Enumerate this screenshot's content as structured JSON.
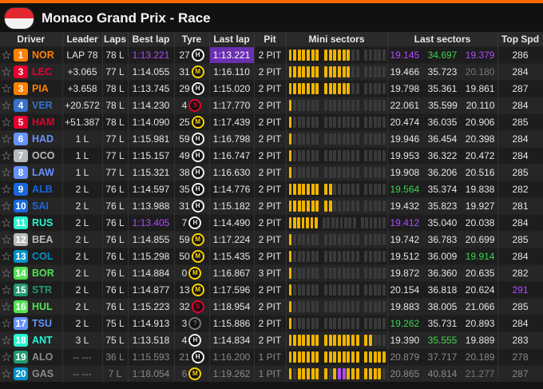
{
  "header": {
    "title": "Monaco Grand Prix - Race",
    "flag_top": "#e4262f",
    "flag_bottom": "#f2f2f2"
  },
  "columns": [
    "Driver",
    "Leader",
    "Laps",
    "Best lap",
    "Tyre",
    "Last lap",
    "Pit",
    "Mini sectors",
    "Last sectors",
    "Top Spd"
  ],
  "colors": {
    "accent": "#ff6a00",
    "purple": "#b04cff",
    "green": "#3fd44f",
    "yellow": "#f0b400",
    "grey": "#3a3a3a"
  },
  "rows": [
    {
      "pos": "1",
      "code": "NOR",
      "team_color": "#ff8000",
      "leader": "LAP 78",
      "laps": "78 L",
      "best": "1:13.221",
      "best_c": "purple",
      "tyre_age": "27",
      "tyre": "H",
      "tyre_color": "#f2f2f2",
      "last": "1:13.221",
      "last_c": "purplebg",
      "pit": "2 PIT",
      "mini": "yyyyyyyyyyyyyggggggg",
      "s1": "19.145",
      "s1c": "purple",
      "s2": "34.697",
      "s2c": "green",
      "s3": "19.379",
      "s3c": "purple",
      "spd": "286",
      "spdc": ""
    },
    {
      "pos": "3",
      "code": "LEC",
      "team_color": "#e8002d",
      "leader": "+3.065",
      "laps": "77 L",
      "best": "1:14.055",
      "best_c": "",
      "tyre_age": "31",
      "tyre": "M",
      "tyre_color": "#ffd400",
      "last": "1:16.110",
      "last_c": "",
      "pit": "2 PIT",
      "mini": "yyyyyyyyyyyyyggggggg",
      "s1": "19.466",
      "s1c": "",
      "s2": "35.723",
      "s2c": "",
      "s3": "20.180",
      "s3c": "dim",
      "spd": "284",
      "spdc": ""
    },
    {
      "pos": "3",
      "code": "PIA",
      "team_color": "#ff8000",
      "leader": "+3.658",
      "laps": "78 L",
      "best": "1:13.745",
      "best_c": "",
      "tyre_age": "29",
      "tyre": "H",
      "tyre_color": "#f2f2f2",
      "last": "1:15.020",
      "last_c": "",
      "pit": "2 PIT",
      "mini": "yyyyyyyyyyyyyggggggg",
      "s1": "19.798",
      "s1c": "",
      "s2": "35.361",
      "s2c": "",
      "s3": "19.861",
      "s3c": "",
      "spd": "287",
      "spdc": ""
    },
    {
      "pos": "4",
      "code": "VER",
      "team_color": "#3671c6",
      "leader": "+20.572",
      "laps": "78 L",
      "best": "1:14.230",
      "best_c": "",
      "tyre_age": "4",
      "tyre": "S",
      "tyre_color": "#e8002d",
      "last": "1:17.770",
      "last_c": "",
      "pit": "2 PIT",
      "mini": "yggggggggggggggggggg",
      "s1": "22.061",
      "s1c": "",
      "s2": "35.599",
      "s2c": "",
      "s3": "20.110",
      "s3c": "",
      "spd": "284",
      "spdc": ""
    },
    {
      "pos": "5",
      "code": "HAM",
      "team_color": "#e8002d",
      "leader": "+51.387",
      "laps": "78 L",
      "best": "1:14.090",
      "best_c": "",
      "tyre_age": "25",
      "tyre": "M",
      "tyre_color": "#ffd400",
      "last": "1:17.439",
      "last_c": "",
      "pit": "2 PIT",
      "mini": "yggggggggggggggggggg",
      "s1": "20.474",
      "s1c": "",
      "s2": "36.035",
      "s2c": "",
      "s3": "20.906",
      "s3c": "",
      "spd": "285",
      "spdc": ""
    },
    {
      "pos": "6",
      "code": "HAD",
      "team_color": "#6692ff",
      "leader": "1 L",
      "laps": "77 L",
      "best": "1:15.981",
      "best_c": "",
      "tyre_age": "59",
      "tyre": "H",
      "tyre_color": "#f2f2f2",
      "last": "1:16.798",
      "last_c": "",
      "pit": "2 PIT",
      "mini": "yggggggggggggggggggg",
      "s1": "19.946",
      "s1c": "",
      "s2": "36.454",
      "s2c": "",
      "s3": "20.398",
      "s3c": "",
      "spd": "284",
      "spdc": ""
    },
    {
      "pos": "7",
      "code": "OCO",
      "team_color": "#b6babd",
      "leader": "1 L",
      "laps": "77 L",
      "best": "1:15.157",
      "best_c": "",
      "tyre_age": "49",
      "tyre": "H",
      "tyre_color": "#f2f2f2",
      "last": "1:16.747",
      "last_c": "",
      "pit": "2 PIT",
      "mini": "yggggggggggggggggggg",
      "s1": "19.953",
      "s1c": "",
      "s2": "36.322",
      "s2c": "",
      "s3": "20.472",
      "s3c": "",
      "spd": "284",
      "spdc": ""
    },
    {
      "pos": "8",
      "code": "LAW",
      "team_color": "#6692ff",
      "leader": "1 L",
      "laps": "77 L",
      "best": "1:15.321",
      "best_c": "",
      "tyre_age": "38",
      "tyre": "H",
      "tyre_color": "#f2f2f2",
      "last": "1:16.630",
      "last_c": "",
      "pit": "2 PIT",
      "mini": "yggggggggggggggggggg",
      "s1": "19.908",
      "s1c": "",
      "s2": "36.206",
      "s2c": "",
      "s3": "20.516",
      "s3c": "",
      "spd": "285",
      "spdc": ""
    },
    {
      "pos": "9",
      "code": "ALB",
      "team_color": "#1868db",
      "leader": "2 L",
      "laps": "76 L",
      "best": "1:14.597",
      "best_c": "",
      "tyre_age": "35",
      "tyre": "H",
      "tyre_color": "#f2f2f2",
      "last": "1:14.776",
      "last_c": "",
      "pit": "2 PIT",
      "mini": "yyyyyyyyyggggggggggg",
      "s1": "19.564",
      "s1c": "green",
      "s2": "35.374",
      "s2c": "",
      "s3": "19.838",
      "s3c": "",
      "spd": "282",
      "spdc": ""
    },
    {
      "pos": "10",
      "code": "SAI",
      "team_color": "#1868db",
      "leader": "2 L",
      "laps": "76 L",
      "best": "1:13.988",
      "best_c": "",
      "tyre_age": "31",
      "tyre": "H",
      "tyre_color": "#f2f2f2",
      "last": "1:15.182",
      "last_c": "",
      "pit": "2 PIT",
      "mini": "yyyyyyyyyggggggggggg",
      "s1": "19.432",
      "s1c": "",
      "s2": "35.823",
      "s2c": "",
      "s3": "19.927",
      "s3c": "",
      "spd": "281",
      "spdc": ""
    },
    {
      "pos": "11",
      "code": "RUS",
      "team_color": "#27f4d2",
      "leader": "2 L",
      "laps": "76 L",
      "best": "1:13.405",
      "best_c": "purple",
      "tyre_age": "7",
      "tyre": "H",
      "tyre_color": "#f2f2f2",
      "last": "1:14.490",
      "last_c": "",
      "pit": "2 PIT",
      "mini": "yyyyyyygggggggggggggg",
      "s1": "19.412",
      "s1c": "purple",
      "s2": "35.040",
      "s2c": "",
      "s3": "20.038",
      "s3c": "",
      "spd": "284",
      "spdc": ""
    },
    {
      "pos": "12",
      "code": "BEA",
      "team_color": "#b6babd",
      "leader": "2 L",
      "laps": "76 L",
      "best": "1:14.855",
      "best_c": "",
      "tyre_age": "59",
      "tyre": "M",
      "tyre_color": "#ffd400",
      "last": "1:17.224",
      "last_c": "",
      "pit": "2 PIT",
      "mini": "yggggggggggggggggggg",
      "s1": "19.742",
      "s1c": "",
      "s2": "36.783",
      "s2c": "",
      "s3": "20.699",
      "s3c": "",
      "spd": "285",
      "spdc": ""
    },
    {
      "pos": "13",
      "code": "COL",
      "team_color": "#0093cc",
      "leader": "2 L",
      "laps": "76 L",
      "best": "1:15.298",
      "best_c": "",
      "tyre_age": "50",
      "tyre": "M",
      "tyre_color": "#ffd400",
      "last": "1:15.435",
      "last_c": "",
      "pit": "2 PIT",
      "mini": "yggggggggggggggggggg",
      "s1": "19.512",
      "s1c": "",
      "s2": "36.009",
      "s2c": "",
      "s3": "19.914",
      "s3c": "green",
      "spd": "284",
      "spdc": ""
    },
    {
      "pos": "14",
      "code": "BOR",
      "team_color": "#52e252",
      "leader": "2 L",
      "laps": "76 L",
      "best": "1:14.884",
      "best_c": "",
      "tyre_age": "0",
      "tyre": "M",
      "tyre_color": "#ffd400",
      "last": "1:16.867",
      "last_c": "",
      "pit": "3 PIT",
      "mini": "yggggggggggggggggggg",
      "s1": "19.872",
      "s1c": "",
      "s2": "36.360",
      "s2c": "",
      "s3": "20.635",
      "s3c": "",
      "spd": "282",
      "spdc": ""
    },
    {
      "pos": "15",
      "code": "STR",
      "team_color": "#229971",
      "leader": "2 L",
      "laps": "76 L",
      "best": "1:14.877",
      "best_c": "",
      "tyre_age": "13",
      "tyre": "M",
      "tyre_color": "#ffd400",
      "last": "1:17.596",
      "last_c": "",
      "pit": "2 PIT",
      "mini": "yggggggggggggggggggg",
      "s1": "20.154",
      "s1c": "",
      "s2": "36.818",
      "s2c": "",
      "s3": "20.624",
      "s3c": "",
      "spd": "291",
      "spdc": "purple"
    },
    {
      "pos": "16",
      "code": "HUL",
      "team_color": "#52e252",
      "leader": "2 L",
      "laps": "76 L",
      "best": "1:15.223",
      "best_c": "",
      "tyre_age": "32",
      "tyre": "S",
      "tyre_color": "#e8002d",
      "last": "1:18.954",
      "last_c": "",
      "pit": "2 PIT",
      "mini": "yggggggggggggggggggg",
      "s1": "19.883",
      "s1c": "",
      "s2": "38.005",
      "s2c": "",
      "s3": "21.066",
      "s3c": "",
      "spd": "285",
      "spdc": ""
    },
    {
      "pos": "17",
      "code": "TSU",
      "team_color": "#6692ff",
      "leader": "2 L",
      "laps": "75 L",
      "best": "1:14.913",
      "best_c": "",
      "tyre_age": "3",
      "tyre": "?",
      "tyre_color": "#777777",
      "last": "1:15.886",
      "last_c": "",
      "pit": "2 PIT",
      "mini": "yggggggggggggggggggg",
      "s1": "19.262",
      "s1c": "green",
      "s2": "35.731",
      "s2c": "",
      "s3": "20.893",
      "s3c": "",
      "spd": "284",
      "spdc": ""
    },
    {
      "pos": "18",
      "code": "ANT",
      "team_color": "#27f4d2",
      "leader": "3 L",
      "laps": "75 L",
      "best": "1:13.518",
      "best_c": "",
      "tyre_age": "4",
      "tyre": "H",
      "tyre_color": "#f2f2f2",
      "last": "1:14.834",
      "last_c": "",
      "pit": "2 PIT",
      "mini": "yyyyyyyyyyyyyyyyyggg",
      "s1": "19.390",
      "s1c": "",
      "s2": "35.555",
      "s2c": "green",
      "s3": "19.889",
      "s3c": "",
      "spd": "283",
      "spdc": ""
    },
    {
      "pos": "19",
      "code": "ALO",
      "team_color": "#229971",
      "leader": "-- ---",
      "laps": "36 L",
      "best": "1:15.593",
      "best_c": "",
      "tyre_age": "21",
      "tyre": "H",
      "tyre_color": "#f2f2f2",
      "last": "1:16.200",
      "last_c": "",
      "pit": "1 PIT",
      "mini": "yyyyyyyyyyyyyyyyyyyy",
      "s1": "20.879",
      "s1c": "",
      "s2": "37.717",
      "s2c": "",
      "s3": "20.189",
      "s3c": "",
      "spd": "278",
      "spdc": "",
      "dim": true
    },
    {
      "pos": "20",
      "code": "GAS",
      "team_color": "#0093cc",
      "leader": "-- ---",
      "laps": "7 L",
      "best": "1:18.054",
      "best_c": "",
      "tyre_age": "6",
      "tyre": "M",
      "tyre_color": "#ffd400",
      "last": "1:19.262",
      "last_c": "",
      "pit": "1 PIT",
      "mini": "ygyyyyyygyppyyyyyyyg",
      "s1": "20.865",
      "s1c": "",
      "s2": "40.814",
      "s2c": "",
      "s3": "21.277",
      "s3c": "dim",
      "spd": "287",
      "spdc": "",
      "dim": true
    }
  ]
}
